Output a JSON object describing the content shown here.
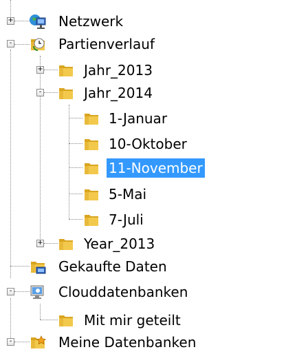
{
  "tree": {
    "nodes": [
      {
        "label": "Netzwerk",
        "icon": "network-icon",
        "expander": "+",
        "selected": false
      },
      {
        "label": "Partienverlauf",
        "icon": "history-icon",
        "expander": "-",
        "selected": false
      },
      {
        "label": "Jahr_2013",
        "icon": "folder-icon",
        "expander": "+",
        "selected": false
      },
      {
        "label": "Jahr_2014",
        "icon": "folder-icon",
        "expander": "-",
        "selected": false
      },
      {
        "label": "1-Januar",
        "icon": "folder-icon",
        "expander": "",
        "selected": false
      },
      {
        "label": "10-Oktober",
        "icon": "folder-icon",
        "expander": "",
        "selected": false
      },
      {
        "label": "11-November",
        "icon": "folder-icon",
        "expander": "",
        "selected": true
      },
      {
        "label": "5-Mai",
        "icon": "folder-icon",
        "expander": "",
        "selected": false
      },
      {
        "label": "7-Juli",
        "icon": "folder-icon",
        "expander": "",
        "selected": false
      },
      {
        "label": "Year_2013",
        "icon": "folder-icon",
        "expander": "+",
        "selected": false
      },
      {
        "label": "Gekaufte Daten",
        "icon": "purchased-data-icon",
        "expander": "",
        "selected": false
      },
      {
        "label": "Clouddatenbanken",
        "icon": "cloud-database-icon",
        "expander": "-",
        "selected": false
      },
      {
        "label": "Mit mir geteilt",
        "icon": "folder-icon",
        "expander": "",
        "selected": false
      },
      {
        "label": "Meine Datenbanken",
        "icon": "my-databases-icon",
        "expander": "-",
        "selected": false
      }
    ]
  },
  "colors": {
    "selection": "#3399ff",
    "folder": "#f2c94c",
    "folder_dark": "#d9a520"
  }
}
